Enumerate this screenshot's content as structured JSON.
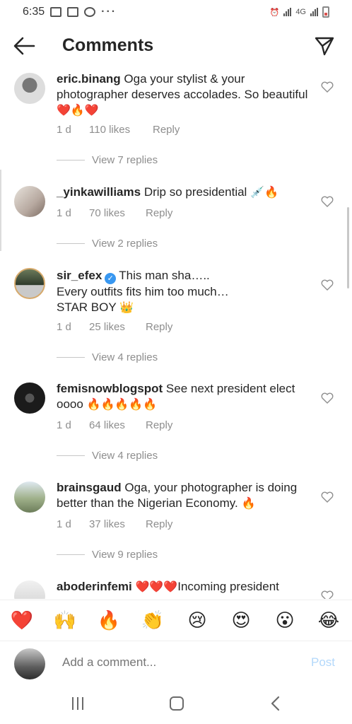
{
  "status": {
    "time": "6:35",
    "dots": "···",
    "network": "4G"
  },
  "header": {
    "title": "Comments"
  },
  "comments": [
    {
      "user": "eric.binang",
      "text": "Oga your stylist & your photographer deserves accolades. So beautiful",
      "emoji": "❤️🔥❤️",
      "time": "1 d",
      "likes": "110 likes",
      "reply": "Reply",
      "view_replies": "View 7 replies"
    },
    {
      "user": "_yinkawilliams",
      "text": "Drip so presidential",
      "emoji": "💉🔥",
      "time": "1 d",
      "likes": "70 likes",
      "reply": "Reply",
      "view_replies": "View 2 replies"
    },
    {
      "user": "sir_efex",
      "text": "This man sha…..\nEvery outfits fits him too much…\nSTAR BOY",
      "emoji": "👑",
      "time": "1 d",
      "likes": "25 likes",
      "reply": "Reply",
      "view_replies": "View 4 replies"
    },
    {
      "user": "femisnowblogspot",
      "text": "See next president elect oooo",
      "emoji": "🔥🔥🔥🔥🔥",
      "time": "1 d",
      "likes": "64 likes",
      "reply": "Reply",
      "view_replies": "View 4 replies"
    },
    {
      "user": "brainsgaud",
      "text": "Oga, your photographer is doing better than the Nigerian Economy.",
      "emoji": "🔥",
      "time": "1 d",
      "likes": "37 likes",
      "reply": "Reply",
      "view_replies": "View 9 replies"
    },
    {
      "user": "aboderinfemi",
      "emoji": "❤️❤️❤️",
      "text": "Incoming president"
    }
  ],
  "reactions": [
    "❤️",
    "🙌",
    "🔥",
    "👏",
    "😢",
    "😍",
    "😮",
    "😂"
  ],
  "compose": {
    "placeholder": "Add a comment...",
    "post_label": "Post"
  }
}
